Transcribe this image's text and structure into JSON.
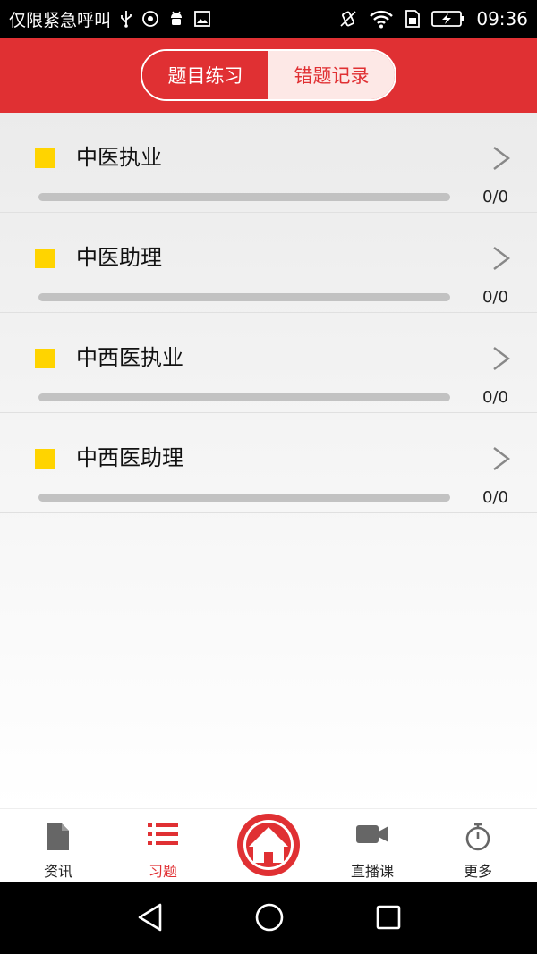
{
  "status_bar": {
    "carrier": "仅限紧急呼叫",
    "time": "09:36"
  },
  "header": {
    "tabs": [
      {
        "label": "题目练习",
        "active": false
      },
      {
        "label": "错题记录",
        "active": true
      }
    ]
  },
  "list": {
    "items": [
      {
        "title": "中医执业",
        "progress_text": "0/0",
        "progress_fraction": 0
      },
      {
        "title": "中医助理",
        "progress_text": "0/0",
        "progress_fraction": 0
      },
      {
        "title": "中西医执业",
        "progress_text": "0/0",
        "progress_fraction": 0
      },
      {
        "title": "中西医助理",
        "progress_text": "0/0",
        "progress_fraction": 0
      }
    ]
  },
  "bottom_nav": {
    "tabs": [
      {
        "label": "资讯",
        "icon": "document-icon",
        "active": false
      },
      {
        "label": "习题",
        "icon": "list-icon",
        "active": true
      },
      {
        "label": "",
        "icon": "home-icon",
        "active": false
      },
      {
        "label": "直播课",
        "icon": "video-camera-icon",
        "active": false
      },
      {
        "label": "更多",
        "icon": "stopwatch-icon",
        "active": false
      }
    ]
  },
  "colors": {
    "brand_red": "#e03033",
    "marker_yellow": "#ffd400",
    "progress_track": "#c2c2c2",
    "inactive_icon": "#666666"
  }
}
